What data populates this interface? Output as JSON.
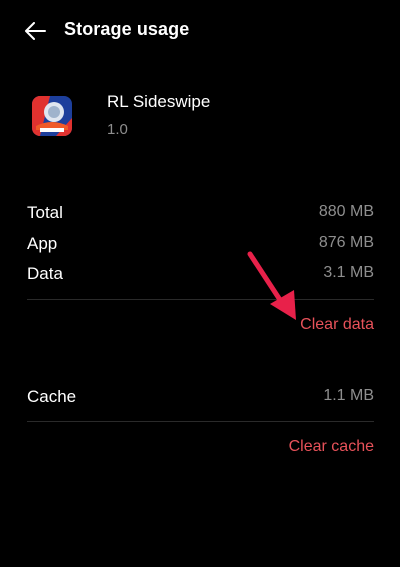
{
  "header": {
    "title": "Storage usage",
    "back_icon": "arrow-left-icon"
  },
  "app": {
    "name": "RL Sideswipe",
    "version": "1.0",
    "icon": "rl-sideswipe-app-icon"
  },
  "storage": {
    "rows": [
      {
        "label": "Total",
        "value": "880 MB"
      },
      {
        "label": "App",
        "value": "876 MB"
      },
      {
        "label": "Data",
        "value": "3.1 MB"
      }
    ],
    "clear_data_label": "Clear data"
  },
  "cache": {
    "label": "Cache",
    "value": "1.1 MB",
    "clear_cache_label": "Clear cache"
  },
  "colors": {
    "background": "#000000",
    "accent": "#e8525a",
    "secondary_text": "#8e8e8e",
    "annotation": "#e8214a"
  }
}
